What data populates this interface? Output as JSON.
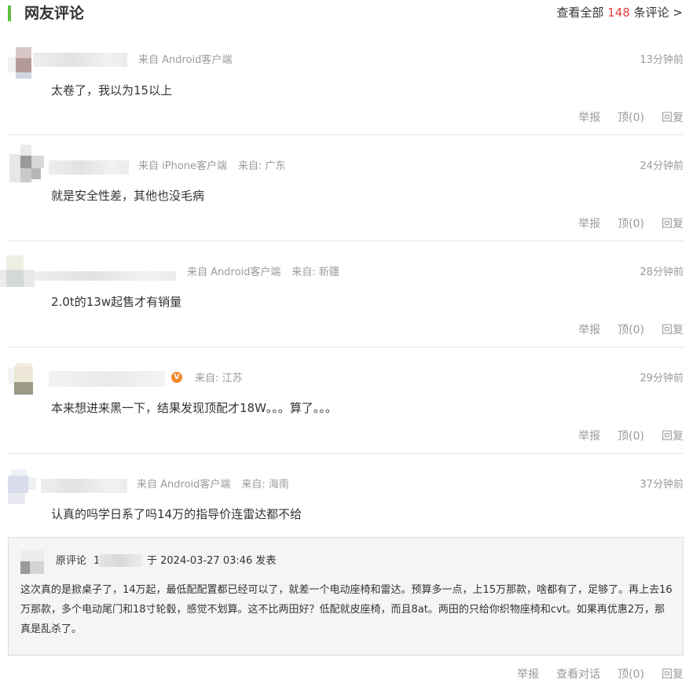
{
  "header": {
    "title": "网友评论",
    "view_all_prefix": "查看全部 ",
    "view_all_count": "148",
    "view_all_suffix": " 条评论 >"
  },
  "comments": [
    {
      "source": "来自 Android客户端",
      "location": "",
      "time": "13分钟前",
      "text": "太卷了，我以为15以上",
      "report": "举报",
      "up": "顶(0)",
      "reply": "回复"
    },
    {
      "source": "来自 iPhone客户端",
      "location": "来自: 广东",
      "time": "24分钟前",
      "text": "就是安全性差，其他也没毛病",
      "report": "举报",
      "up": "顶(0)",
      "reply": "回复"
    },
    {
      "source": "来自 Android客户端",
      "location": "来自: 新疆",
      "time": "28分钟前",
      "text": "2.0t的13w起售才有销量",
      "report": "举报",
      "up": "顶(0)",
      "reply": "回复"
    },
    {
      "source": "",
      "location": "来自: 江苏",
      "time": "29分钟前",
      "text": "本来想进来黑一下，结果发现顶配才18W。。。算了。。。",
      "report": "举报",
      "up": "顶(0)",
      "reply": "回复",
      "badge": "V"
    },
    {
      "source": "来自 Android客户端",
      "location": "来自: 海南",
      "time": "37分钟前",
      "text": "认真的吗学日系了吗14万的指导价连雷达都不给"
    }
  ],
  "quote": {
    "label": "原评论",
    "name_initial": "1",
    "date": "于 2024-03-27 03:46  发表",
    "text": "这次真的是掀桌子了，14万起，最低配配置都已经可以了，就差一个电动座椅和雷达。预算多一点，上15万那款，啥都有了，足够了。再上去16万那款，多个电动尾门和18寸轮毂，感觉不划算。这不比两田好？低配就皮座椅，而且8at。两田的只给你织物座椅和cvt。如果再优惠2万，那真是乱杀了。"
  },
  "bottom_actions": {
    "report": "举报",
    "view_conversation": "查看对话",
    "up": "顶(0)",
    "reply": "回复"
  }
}
